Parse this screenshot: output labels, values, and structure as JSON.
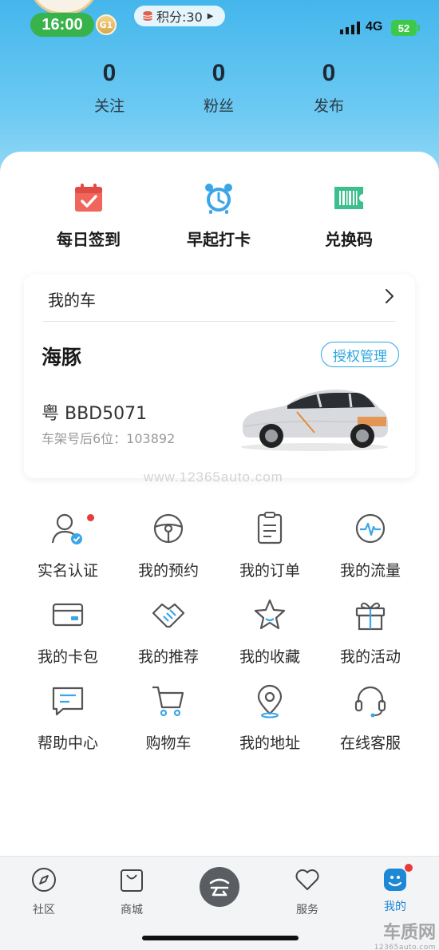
{
  "status_bar": {
    "time": "16:00",
    "level": "G1",
    "points_label": "积分:30",
    "network": "4G",
    "battery": "52"
  },
  "stats": [
    {
      "value": "0",
      "label": "关注"
    },
    {
      "value": "0",
      "label": "粉丝"
    },
    {
      "value": "0",
      "label": "发布"
    }
  ],
  "quick_actions": [
    {
      "label": "每日签到",
      "icon": "calendar-check-icon",
      "color": "#f0655c"
    },
    {
      "label": "早起打卡",
      "icon": "alarm-clock-icon",
      "color": "#3aa6e8"
    },
    {
      "label": "兑换码",
      "icon": "barcode-ticket-icon",
      "color": "#3cbf8c"
    }
  ],
  "car_card": {
    "header": "我的车",
    "model": "海豚",
    "auth_button": "授权管理",
    "plate": "粤 BBD5071",
    "vin_label": "车架号后6位：103892"
  },
  "watermark": "www.12365auto.com",
  "services": [
    {
      "label": "实名认证",
      "icon": "user-verified-icon"
    },
    {
      "label": "我的预约",
      "icon": "steering-wheel-icon"
    },
    {
      "label": "我的订单",
      "icon": "order-list-icon"
    },
    {
      "label": "我的流量",
      "icon": "data-pulse-icon"
    },
    {
      "label": "我的卡包",
      "icon": "card-wallet-icon"
    },
    {
      "label": "我的推荐",
      "icon": "handshake-icon"
    },
    {
      "label": "我的收藏",
      "icon": "star-icon"
    },
    {
      "label": "我的活动",
      "icon": "gift-icon"
    },
    {
      "label": "帮助中心",
      "icon": "chat-bubble-icon"
    },
    {
      "label": "购物车",
      "icon": "shopping-cart-icon"
    },
    {
      "label": "我的地址",
      "icon": "location-pin-icon"
    },
    {
      "label": "在线客服",
      "icon": "headset-icon"
    }
  ],
  "tabs": [
    {
      "label": "社区",
      "icon": "compass-icon"
    },
    {
      "label": "商城",
      "icon": "shopping-bag-icon"
    },
    {
      "label": "",
      "icon": "cloud-logo-icon"
    },
    {
      "label": "服务",
      "icon": "heart-icon"
    },
    {
      "label": "我的",
      "icon": "profile-icon"
    }
  ],
  "brand_mark": {
    "text": "车质网",
    "sub": "12365auto.com"
  },
  "colors": {
    "accent": "#2aa6e0",
    "active_tab": "#1e88d6",
    "notice_dot": "#e83a3a"
  }
}
